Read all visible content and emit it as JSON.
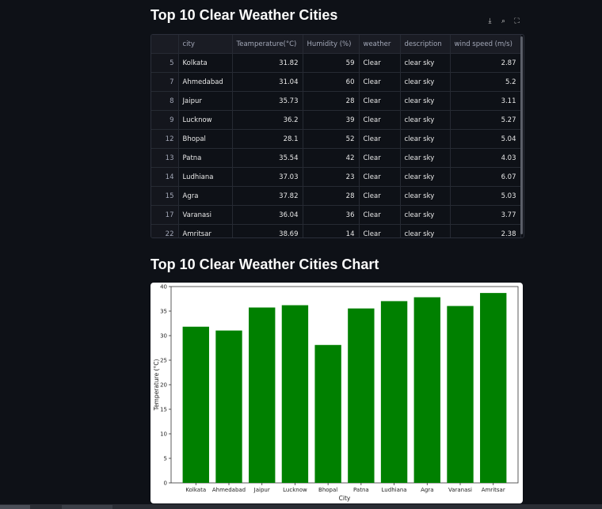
{
  "section1": {
    "title": "Top 10 Clear Weather Cities"
  },
  "toolbar": {
    "download_icon": "download-icon",
    "search_icon": "search-icon",
    "fullscreen_icon": "fullscreen-icon"
  },
  "table": {
    "columns": [
      "",
      "city",
      "Teamperature(°C)",
      "Humidity (%)",
      "weather",
      "description",
      "wind speed (m/s)"
    ],
    "rows": [
      [
        "5",
        "Kolkata",
        "31.82",
        "59",
        "Clear",
        "clear sky",
        "2.87"
      ],
      [
        "7",
        "Ahmedabad",
        "31.04",
        "60",
        "Clear",
        "clear sky",
        "5.2"
      ],
      [
        "8",
        "Jaipur",
        "35.73",
        "28",
        "Clear",
        "clear sky",
        "3.11"
      ],
      [
        "9",
        "Lucknow",
        "36.2",
        "39",
        "Clear",
        "clear sky",
        "5.27"
      ],
      [
        "12",
        "Bhopal",
        "28.1",
        "52",
        "Clear",
        "clear sky",
        "5.04"
      ],
      [
        "13",
        "Patna",
        "35.54",
        "42",
        "Clear",
        "clear sky",
        "4.03"
      ],
      [
        "14",
        "Ludhiana",
        "37.03",
        "23",
        "Clear",
        "clear sky",
        "6.07"
      ],
      [
        "15",
        "Agra",
        "37.82",
        "28",
        "Clear",
        "clear sky",
        "5.03"
      ],
      [
        "17",
        "Varanasi",
        "36.04",
        "36",
        "Clear",
        "clear sky",
        "3.77"
      ],
      [
        "22",
        "Amritsar",
        "38.69",
        "14",
        "Clear",
        "clear sky",
        "2.38"
      ]
    ]
  },
  "section2": {
    "title": "Top 10 Clear Weather Cities Chart"
  },
  "chart_data": {
    "type": "bar",
    "categories": [
      "Kolkata",
      "Ahmedabad",
      "Jaipur",
      "Lucknow",
      "Bhopal",
      "Patna",
      "Ludhiana",
      "Agra",
      "Varanasi",
      "Amritsar"
    ],
    "values": [
      31.82,
      31.04,
      35.73,
      36.2,
      28.1,
      35.54,
      37.03,
      37.82,
      36.04,
      38.69
    ],
    "title": "",
    "xlabel": "City",
    "ylabel": "Temperature (°C)",
    "ylim": [
      0,
      40
    ],
    "yticks": [
      0,
      5,
      10,
      15,
      20,
      25,
      30,
      35,
      40
    ],
    "color": "#008000",
    "grid": false
  }
}
